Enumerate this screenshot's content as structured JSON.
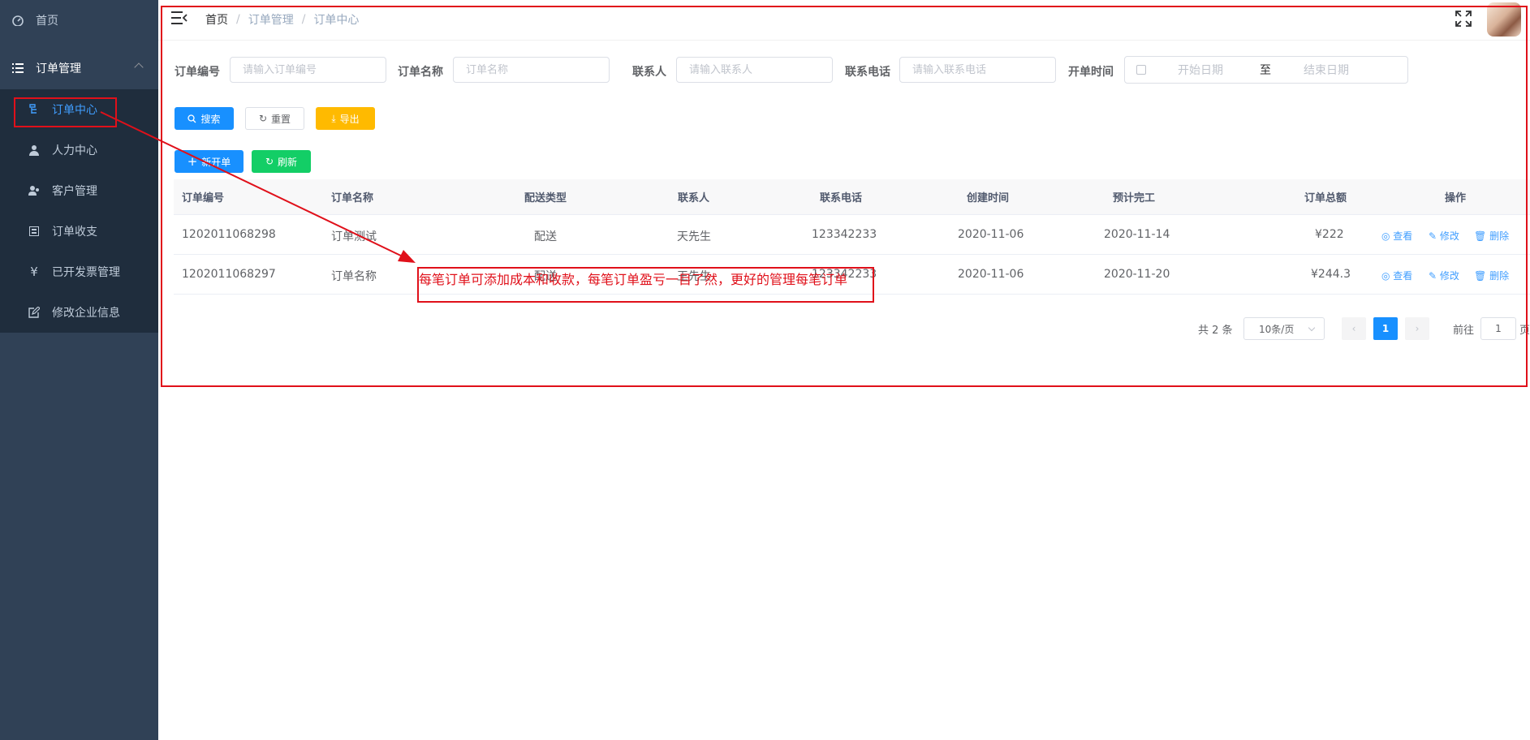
{
  "sidebar": {
    "home": "首页",
    "group": "订单管理",
    "items": [
      {
        "label": "订单中心",
        "icon": "order-center-icon"
      },
      {
        "label": "人力中心",
        "icon": "user-icon"
      },
      {
        "label": "客户管理",
        "icon": "customer-icon"
      },
      {
        "label": "订单收支",
        "icon": "finance-icon"
      },
      {
        "label": "已开发票管理",
        "icon": "yen-icon"
      },
      {
        "label": "修改企业信息",
        "icon": "edit-icon"
      }
    ]
  },
  "header": {
    "breadcrumb": [
      "首页",
      "订单管理",
      "订单中心"
    ]
  },
  "filters": {
    "order_no": {
      "label": "订单编号",
      "placeholder": "请输入订单编号"
    },
    "order_name": {
      "label": "订单名称",
      "placeholder": "订单名称"
    },
    "contact": {
      "label": "联系人",
      "placeholder": "请输入联系人"
    },
    "phone": {
      "label": "联系电话",
      "placeholder": "请输入联系电话"
    },
    "open_time": {
      "label": "开单时间",
      "start": "开始日期",
      "to": "至",
      "end": "结束日期"
    }
  },
  "buttons": {
    "search": "搜索",
    "reset": "重置",
    "export": "导出",
    "new_order": "新开单",
    "refresh": "刷新"
  },
  "table": {
    "columns": [
      "订单编号",
      "订单名称",
      "配送类型",
      "联系人",
      "联系电话",
      "创建时间",
      "预计完工",
      "订单总额",
      "操作"
    ],
    "rows": [
      {
        "order_no": "1202011068298",
        "name": "订单测试",
        "type": "配送",
        "contact": "天先生",
        "phone": "123342233",
        "created": "2020-11-06",
        "due": "2020-11-14",
        "total": "¥222"
      },
      {
        "order_no": "1202011068297",
        "name": "订单名称",
        "type": "配送",
        "contact": "王先生",
        "phone": "123342233",
        "created": "2020-11-06",
        "due": "2020-11-20",
        "total": "¥244.3"
      }
    ],
    "ops": {
      "view": "查看",
      "edit": "修改",
      "delete": "删除"
    }
  },
  "pagination": {
    "total_text": "共 2 条",
    "page_size": "10条/页",
    "current_page": "1",
    "goto_prefix": "前往",
    "goto_value": "1",
    "goto_suffix": "页"
  },
  "annotation": {
    "text": "每笔订单可添加成本和收款，每笔订单盈亏一目了然，更好的管理每笔订单",
    "color": "#e0101a"
  },
  "colors": {
    "sidebar_bg": "#304156",
    "accent": "#1890ff",
    "warning": "#ffba00",
    "success": "#13ce66"
  }
}
